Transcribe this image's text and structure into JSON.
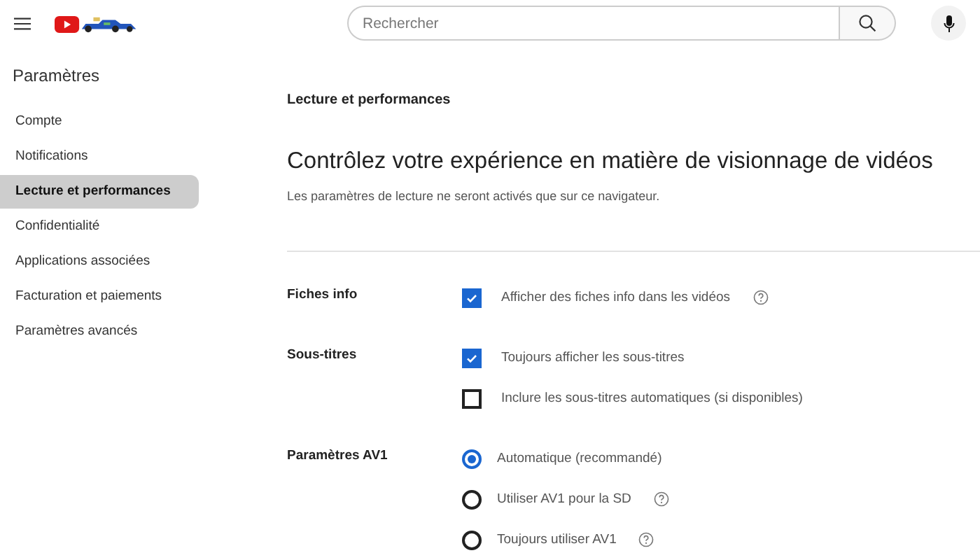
{
  "search": {
    "placeholder": "Rechercher"
  },
  "sidebar": {
    "title": "Paramètres",
    "items": [
      {
        "label": "Compte",
        "selected": false
      },
      {
        "label": "Notifications",
        "selected": false
      },
      {
        "label": "Lecture et performances",
        "selected": true
      },
      {
        "label": "Confidentialité",
        "selected": false
      },
      {
        "label": "Applications associées",
        "selected": false
      },
      {
        "label": "Facturation et paiements",
        "selected": false
      },
      {
        "label": "Paramètres avancés",
        "selected": false
      }
    ]
  },
  "page": {
    "section_title": "Lecture et performances",
    "heading": "Contrôlez votre expérience en matière de visionnage de vidéos",
    "subtitle": "Les paramètres de lecture ne seront activés que sur ce navigateur."
  },
  "groups": [
    {
      "label": "Fiches info",
      "options": [
        {
          "kind": "checkbox",
          "label": "Afficher des fiches info dans les vidéos",
          "checked": true,
          "help": true
        }
      ]
    },
    {
      "label": "Sous-titres",
      "options": [
        {
          "kind": "checkbox",
          "label": "Toujours afficher les sous-titres",
          "checked": true,
          "help": false
        },
        {
          "kind": "checkbox",
          "label": "Inclure les sous-titres automatiques (si disponibles)",
          "checked": false,
          "help": false
        }
      ]
    },
    {
      "label": "Paramètres AV1",
      "options": [
        {
          "kind": "radio",
          "label": "Automatique (recommandé)",
          "selected": true,
          "help": false
        },
        {
          "kind": "radio",
          "label": "Utiliser AV1 pour la SD",
          "selected": false,
          "help": true
        },
        {
          "kind": "radio",
          "label": "Toujours utiliser AV1",
          "selected": false,
          "help": true
        }
      ]
    }
  ]
}
